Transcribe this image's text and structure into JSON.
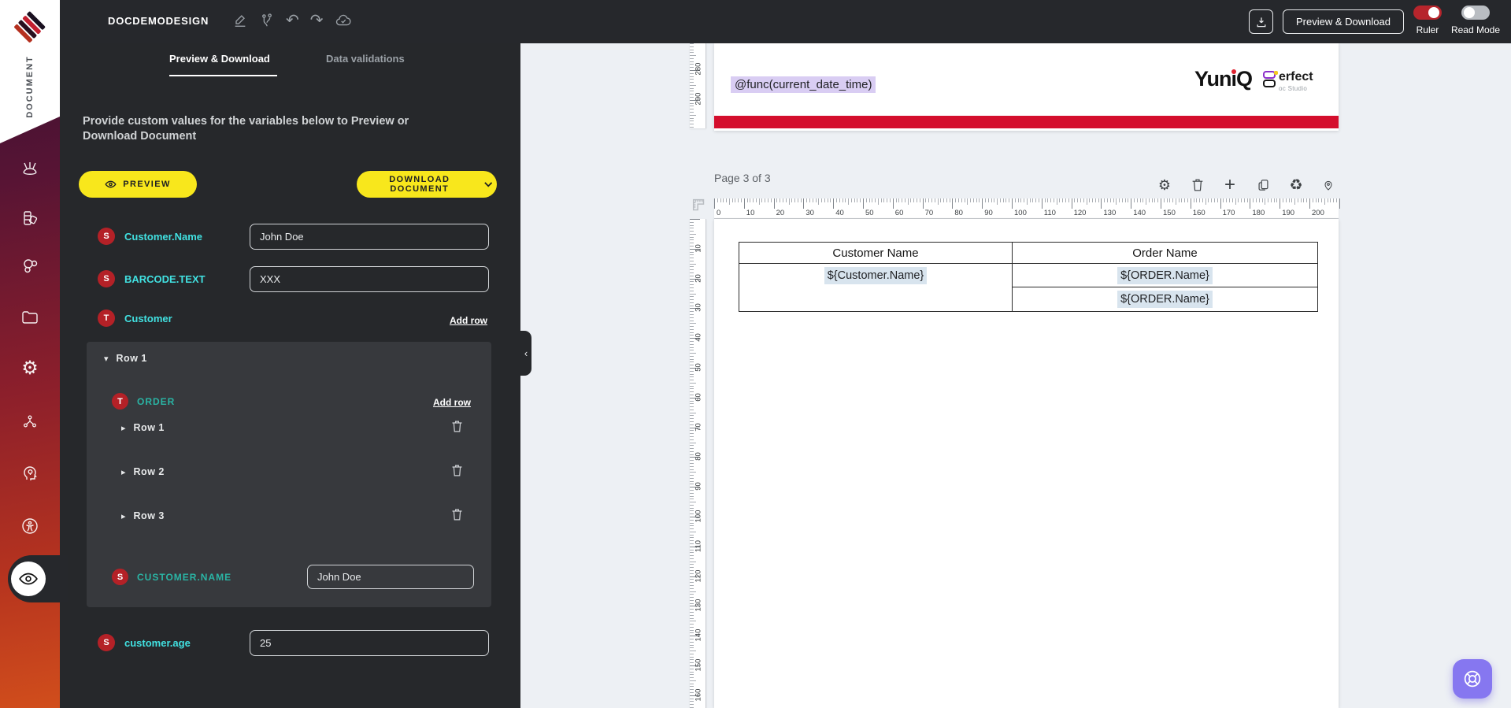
{
  "topbar": {
    "title": "DOCDEMODESIGN",
    "preview_download_label": "Preview & Download",
    "ruler_label": "Ruler",
    "ruler_on": true,
    "read_mode_label": "Read Mode",
    "read_mode_on": false
  },
  "sidebar": {
    "brand_label": "DOCUMENT",
    "icon_names": [
      "design-tools",
      "color-swatches",
      "molecule",
      "folder",
      "settings-gear",
      "node-network",
      "idea-head",
      "accessibility",
      "preview-eye"
    ]
  },
  "panel": {
    "tabs": [
      {
        "label": "Preview & Download",
        "active": true
      },
      {
        "label": "Data validations",
        "active": false
      }
    ],
    "description": "Provide custom values for the variables below to Preview or Download Document",
    "preview_button_label": "PREVIEW",
    "download_button_label": "DOWNLOAD DOCUMENT",
    "add_row_label": "Add row",
    "fields": {
      "customer_name": {
        "badge": "S",
        "label": "Customer.Name",
        "value": "John Doe"
      },
      "barcode_text": {
        "badge": "S",
        "label": "BARCODE.TEXT",
        "value": "XXX"
      },
      "customer": {
        "badge": "T",
        "label": "Customer"
      },
      "customer_age": {
        "badge": "S",
        "label": "customer.age",
        "value": "25"
      }
    },
    "row_group": {
      "header_label": "Row 1",
      "order": {
        "badge": "T",
        "label": "ORDER"
      },
      "rows": [
        {
          "label": "Row 1"
        },
        {
          "label": "Row 2"
        },
        {
          "label": "Row 3"
        }
      ],
      "field": {
        "badge": "S",
        "label": "CUSTOMER.NAME",
        "value": "John Doe"
      }
    }
  },
  "canvas": {
    "page_label": "Page 3 of 3",
    "date_variable": "@func(current_date_time)",
    "brand": {
      "yuniq": "YuniQ",
      "perfect": "erfect",
      "perfect_sub": "oc Studio"
    },
    "h_ruler_labels": [
      "0",
      "10",
      "20",
      "30",
      "40",
      "50",
      "60",
      "70",
      "80",
      "90",
      "100",
      "110",
      "120",
      "130",
      "140",
      "150",
      "160",
      "170",
      "180",
      "190",
      "200"
    ],
    "v_ruler_labels": [
      "10",
      "20",
      "30",
      "40",
      "50",
      "60",
      "70",
      "80",
      "90",
      "100",
      "110",
      "120",
      "130",
      "140",
      "150",
      "160"
    ],
    "v_ruler_top_labels": [
      "280",
      "290"
    ],
    "table": {
      "headers": [
        "Customer Name",
        "Order Name"
      ],
      "customer_value": "${Customer.Name}",
      "order_values": [
        "${ORDER.Name}",
        "${ORDER.Name}"
      ]
    }
  },
  "glyphs": {
    "gear": "⚙",
    "recycle": "♻",
    "plus": "+",
    "undo": "↶",
    "redo": "↷",
    "caret_down": "▾",
    "caret_right": "▸",
    "chevron_left": "‹"
  },
  "colors": {
    "accent_yellow": "#f8e71c",
    "badge_red": "#b42127",
    "label_cyan": "#41e1e1",
    "label_teal": "#2ab5a5",
    "doc_red_bar": "#d40e2d",
    "highlight_lavender": "#d9cdf3",
    "highlight_blue": "#d8e4ee",
    "fab_purple": "#8677f0",
    "toggle_red": "#b6252c"
  }
}
